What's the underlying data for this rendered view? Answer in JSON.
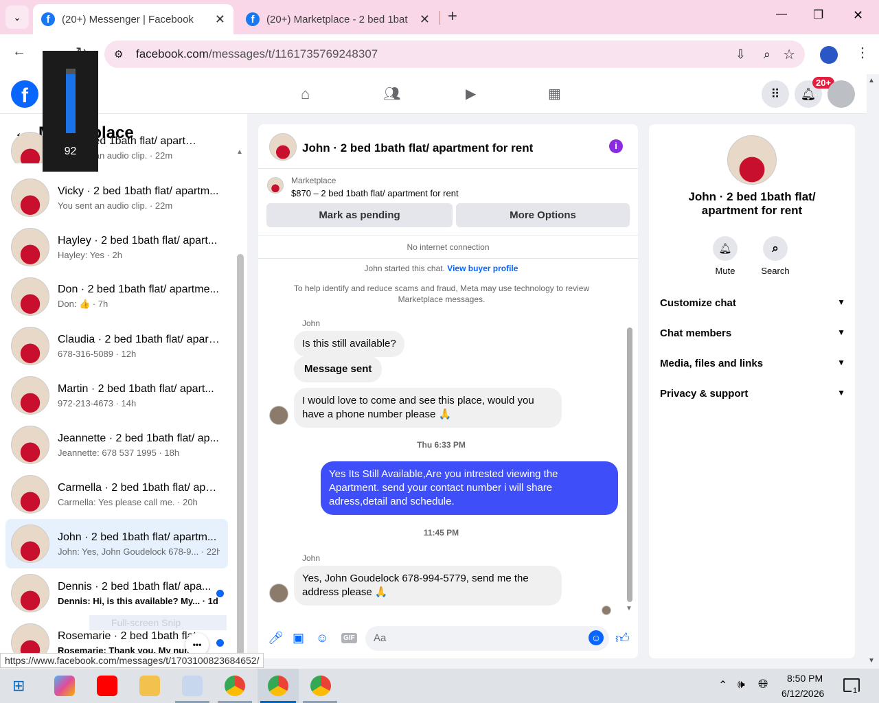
{
  "tabs": [
    {
      "title": "(20+) Messenger | Facebook",
      "close": "✕"
    },
    {
      "title": "(20+) Marketplace - 2 bed 1bat",
      "close": "✕"
    }
  ],
  "new_tab": "+",
  "window": {
    "min": "—",
    "max": "❐",
    "close": "✕"
  },
  "address": {
    "url_host": "facebook.com",
    "url_path": "/messages/t/1161735769248307"
  },
  "header": {
    "notif_badge": "20+"
  },
  "volume": {
    "level": "92",
    "fraction": 0.92
  },
  "left": {
    "title": "Marketplace",
    "top_partial": {
      "name": "… · 2 bed 1bath flat/ apart…",
      "sub": "You sent an audio clip. · 22m"
    },
    "rows": [
      {
        "name": "Vicky · 2 bed 1bath flat/ apartm...",
        "sub": "You sent an audio clip. · 22m"
      },
      {
        "name": "Hayley · 2 bed 1bath flat/ apart...",
        "sub": "Hayley: Yes · 2h"
      },
      {
        "name": "Don · 2 bed 1bath flat/ apartme...",
        "sub": "Don: 👍 · 7h"
      },
      {
        "name": "Claudia · 2 bed 1bath flat/ apart...",
        "sub": "678-316-5089 · 12h"
      },
      {
        "name": "Martin · 2 bed 1bath flat/ apart...",
        "sub": "972-213-4673 · 14h"
      },
      {
        "name": "Jeannette · 2 bed 1bath flat/ ap...",
        "sub": "Jeannette: 678 537 1995 · 18h"
      },
      {
        "name": "Carmella · 2 bed 1bath flat/ apa...",
        "sub": "Carmella: Yes please call me. · 20h"
      },
      {
        "name": "John · 2 bed 1bath flat/ apartm...",
        "sub": "John: Yes, John Goudelock 678-9... · 22h"
      },
      {
        "name": "Dennis · 2 bed 1bath flat/ apa...",
        "sub": "Dennis: Hi, is this available? My... · 1d"
      },
      {
        "name": "Rosemarie · 2 bed 1bath flat",
        "sub": "Rosemarie: Thank you. My num..."
      }
    ],
    "snip_hint": "Full-screen Snip",
    "more": "•••"
  },
  "chat": {
    "title": "John · 2 bed 1bath flat/ apartment for rent",
    "listing_label": "Marketplace",
    "listing_desc": "$870 – 2 bed 1bath flat/ apartment for rent",
    "btn_pending": "Mark as pending",
    "btn_more": "More Options",
    "no_internet": "No internet connection",
    "started": "John started this chat.",
    "view_buyer": "View buyer profile",
    "scam_notice": "To help identify and reduce scams and fraud, Meta may use technology to review Marketplace messages.",
    "sender1": "John",
    "msg1": "Is this still available?",
    "msg2": "Message sent",
    "msg3": "I would love to come and see this place, would you have a phone number please 🙏",
    "time1": "Thu 6:33 PM",
    "msg4": "Yes Its Still Available,Are you intrested viewing the Apartment. send your contact number i will share adress,detail and schedule.",
    "time2": "11:45 PM",
    "sender2": "John",
    "msg5": "Yes, John Goudelock 678-994-5779, send me the address please 🙏",
    "input_placeholder": "Aa",
    "accent": "#3e4ef8"
  },
  "right": {
    "name": "John · 2 bed 1bath flat/ apartment for rent",
    "mute": "Mute",
    "search": "Search",
    "sections": [
      "Customize chat",
      "Chat members",
      "Media, files and links",
      "Privacy & support"
    ]
  },
  "status_url": "https://www.facebook.com/messages/t/1703100823684652/",
  "taskbar": {
    "time": "8:50 PM",
    "date": "6/12/2026",
    "notif_count": "1"
  }
}
